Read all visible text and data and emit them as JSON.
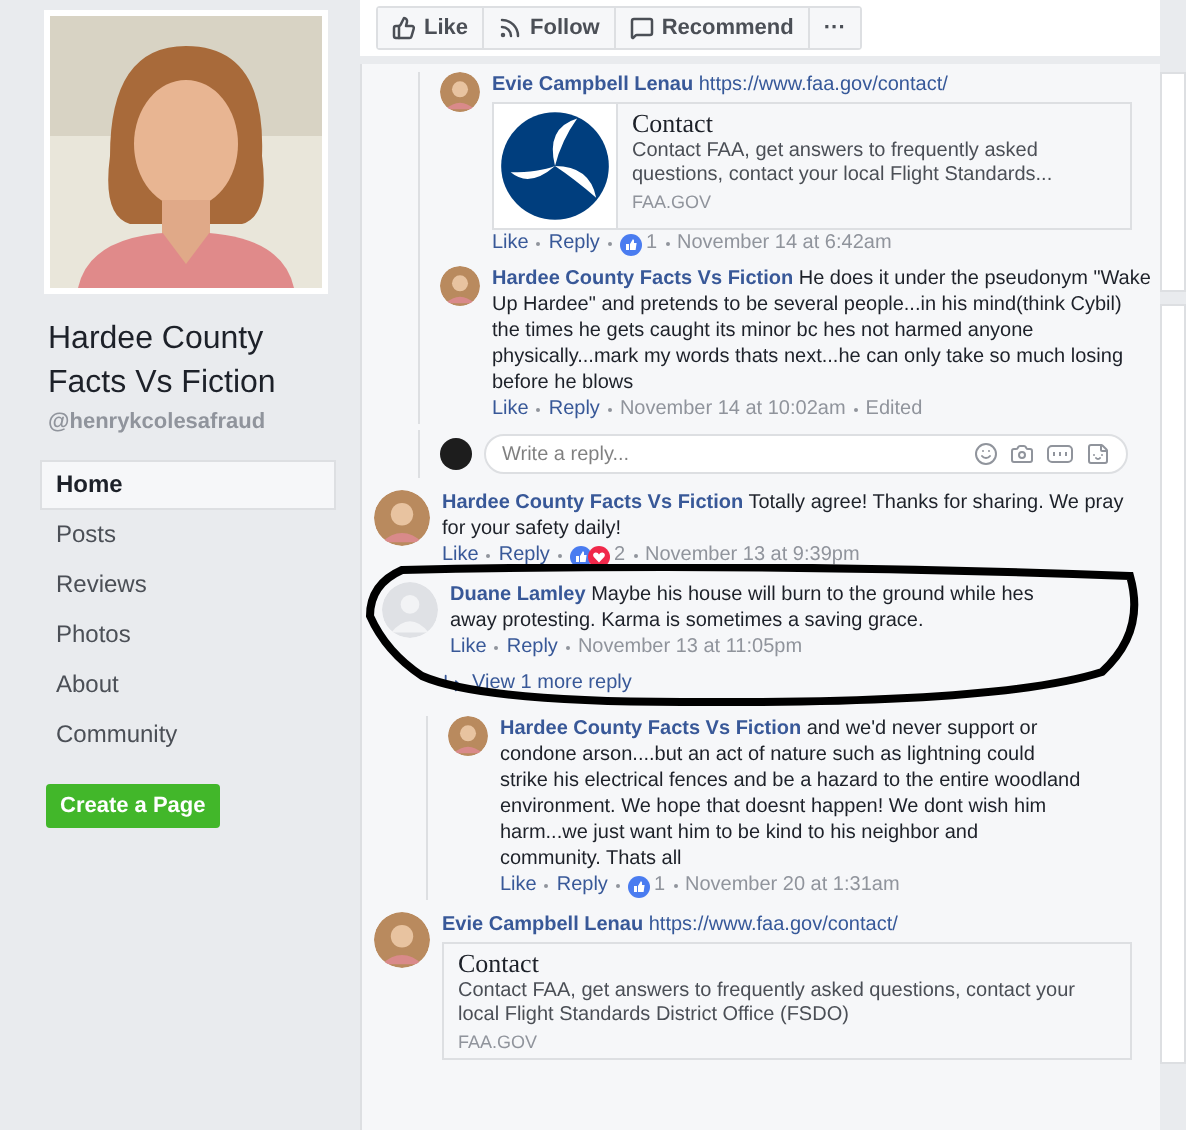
{
  "page": {
    "name": "Hardee County Facts Vs Fiction",
    "handle": "@henrykcolesafraud",
    "nav": [
      {
        "label": "Home",
        "selected": true
      },
      {
        "label": "Posts",
        "selected": false
      },
      {
        "label": "Reviews",
        "selected": false
      },
      {
        "label": "Photos",
        "selected": false
      },
      {
        "label": "About",
        "selected": false
      },
      {
        "label": "Community",
        "selected": false
      }
    ],
    "create_button": "Create a Page"
  },
  "actions": [
    {
      "kind": "like",
      "label": "Like"
    },
    {
      "kind": "follow",
      "label": "Follow"
    },
    {
      "kind": "recommend",
      "label": "Recommend"
    },
    {
      "kind": "more",
      "label": "···"
    }
  ],
  "threads": [
    {
      "replies": [
        {
          "has_photo": true,
          "author": "Evie Campbell Lenau",
          "text": "https://www.faa.gov/contact/",
          "preview": {
            "image": true,
            "title": "Contact",
            "description": "Contact FAA, get answers to frequently asked questions, contact your local Flight Standards...",
            "domain": "FAA.GOV"
          },
          "like": "Like",
          "reply": "Reply",
          "reactions": {
            "like": true,
            "love": false,
            "count": "1"
          },
          "time": "November 14 at 6:42am"
        },
        {
          "has_photo": true,
          "author": "Hardee County Facts Vs Fiction",
          "text": "He does it under the pseudonym \"Wake Up Hardee\" and pretends to be several people...in his mind(think Cybil) the times he gets caught its minor bc hes not harmed anyone physically...mark my words thats next...he can only take so much losing before he blows",
          "like": "Like",
          "reply": "Reply",
          "time": "November 14 at 10:02am",
          "edited": "Edited"
        }
      ],
      "reply_field": {
        "placeholder": "Write a reply..."
      }
    },
    {
      "comment": {
        "has_photo": true,
        "author": "Hardee County Facts Vs Fiction",
        "text": "Totally agree! Thanks for sharing. We pray for your safety daily!",
        "like": "Like",
        "reply": "Reply",
        "reactions": {
          "like": true,
          "love": true,
          "count": "2"
        },
        "time": "November 13 at 9:39pm"
      }
    },
    {
      "circled": true,
      "comment": {
        "has_photo": false,
        "author": "Duane Lamley",
        "text": "Maybe his house will burn to the ground while hes away protesting. Karma is sometimes a saving grace.",
        "like": "Like",
        "reply": "Reply",
        "time": "November 13 at 11:05pm"
      },
      "more_replies": "View 1 more reply",
      "replies": [
        {
          "has_photo": true,
          "author": "Hardee County Facts Vs Fiction",
          "text": "and we'd never support or condone arson....but an act of nature such as lightning could strike his electrical fences and be a hazard to the entire woodland environment. We hope that doesnt happen! We dont wish him harm...we just want him to be kind to his neighbor and community. Thats all",
          "like": "Like",
          "reply": "Reply",
          "reactions": {
            "like": true,
            "love": false,
            "count": "1"
          },
          "time": "November 20 at 1:31am"
        }
      ]
    },
    {
      "comment": {
        "has_photo": true,
        "author": "Evie Campbell Lenau",
        "text": "https://www.faa.gov/contact/",
        "preview": {
          "image": false,
          "title": "Contact",
          "description": "Contact FAA, get answers to frequently asked questions, contact your local Flight Standards District Office (FSDO)",
          "domain": "FAA.GOV"
        }
      }
    }
  ]
}
